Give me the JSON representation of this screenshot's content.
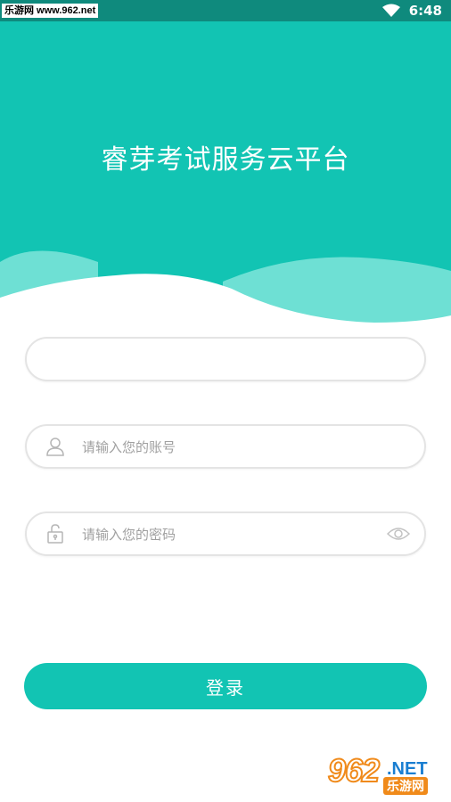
{
  "status_bar": {
    "watermark": "乐游网 www.962.net",
    "time": "6:48",
    "wifi_icon": "wifi-icon"
  },
  "header": {
    "title": "睿芽考试服务云平台"
  },
  "form": {
    "field1": {
      "value": "",
      "placeholder": ""
    },
    "account": {
      "placeholder": "请输入您的账号",
      "icon": "user-icon"
    },
    "password": {
      "placeholder": "请输入您的密码",
      "icon": "lock-icon",
      "toggle_icon": "eye-icon"
    },
    "login_label": "登录"
  },
  "brand": {
    "mark_number": "962",
    "mark_net": ".NET",
    "mark_cn": "乐游网"
  },
  "colors": {
    "primary": "#12c4b3",
    "status_bar": "#0f8a7d",
    "wave_light": "#6ee0d4",
    "field_border": "#e4e4e4",
    "placeholder": "#a0a0a0"
  }
}
